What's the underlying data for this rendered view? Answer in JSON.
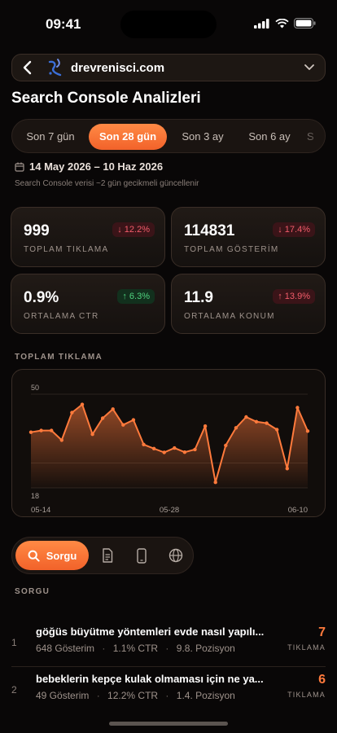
{
  "status_bar": {
    "time": "09:41"
  },
  "header": {
    "site_name": "drevrenisci.com",
    "page_title": "Search Console Analizleri"
  },
  "range_tabs": [
    {
      "label": "Son 7 gün",
      "active": false
    },
    {
      "label": "Son 28 gün",
      "active": true
    },
    {
      "label": "Son 3 ay",
      "active": false
    },
    {
      "label": "Son 6 ay",
      "active": false
    },
    {
      "label": "S",
      "active": false
    }
  ],
  "date_range": {
    "text": "14 May 2026 – 10 Haz 2026",
    "note": "Search Console verisi ~2 gün gecikmeli güncellenir"
  },
  "kpis": [
    {
      "value": "999",
      "label": "TOPLAM TIKLAMA",
      "change": "↓ 12.2%",
      "trend": "down"
    },
    {
      "value": "114831",
      "label": "TOPLAM GÖSTERİM",
      "change": "↓ 17.4%",
      "trend": "down"
    },
    {
      "value": "0.9%",
      "label": "ORTALAMA CTR",
      "change": "↑ 6.3%",
      "trend": "up"
    },
    {
      "value": "11.9",
      "label": "ORTALAMA KONUM",
      "change": "↑ 13.9%",
      "trend": "down"
    }
  ],
  "chart_section": {
    "title": "TOPLAM TIKLAMA"
  },
  "chart_data": {
    "type": "area",
    "title": "TOPLAM TIKLAMA",
    "y_tick_labels": [
      "50",
      "18"
    ],
    "ylim": [
      18,
      50
    ],
    "x_tick_labels": [
      "05-14",
      "05-28",
      "06-10"
    ],
    "values": [
      37,
      37.6,
      37.6,
      34.3,
      43.7,
      46.5,
      36.3,
      41.8,
      44.9,
      39.5,
      41.2,
      32.8,
      31.4,
      30.1,
      31.6,
      30.2,
      31.1,
      39.1,
      19.9,
      32.5,
      38.5,
      42.2,
      40.6,
      40.1,
      37.9,
      24.6,
      45.4,
      37.4
    ],
    "color": "#ff7a3c",
    "grid": true
  },
  "segment": {
    "active_label": "Sorgu"
  },
  "section_label": "SORGU",
  "queries": [
    {
      "index": "1",
      "title": "göğüs büyütme yöntemleri evde nasıl yapılı...",
      "impressions": "648 Gösterim",
      "ctr": "1.1% CTR",
      "position": "9.8. Pozisyon",
      "clicks": "7",
      "clicks_label": "TIKLAMA"
    },
    {
      "index": "2",
      "title": "bebeklerin kepçe kulak olmaması için ne ya...",
      "impressions": "49 Gösterim",
      "ctr": "12.2% CTR",
      "position": "1.4. Pozisyon",
      "clicks": "6",
      "clicks_label": "TIKLAMA"
    }
  ]
}
